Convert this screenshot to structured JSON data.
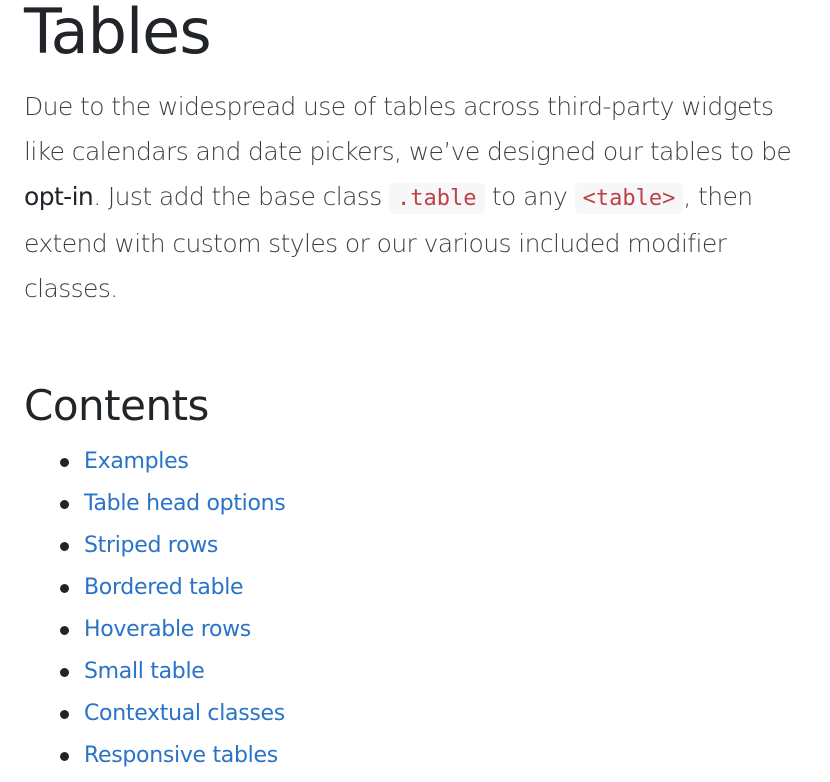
{
  "page": {
    "title": "Tables",
    "lead": {
      "part1": "Due to the widespread use of tables across third-party widgets like calendars and date pickers, we’ve designed our tables to be ",
      "emphasis": "opt-in",
      "part2": ". Just add the base class ",
      "code1": ".table",
      "part3": " to any ",
      "code2": "<table>",
      "part4": ", then extend with custom styles or our various included modifier classes."
    }
  },
  "contents": {
    "title": "Contents",
    "items": [
      {
        "label": "Examples"
      },
      {
        "label": "Table head options"
      },
      {
        "label": "Striped rows"
      },
      {
        "label": "Bordered table"
      },
      {
        "label": "Hoverable rows"
      },
      {
        "label": "Small table"
      },
      {
        "label": "Contextual classes"
      },
      {
        "label": "Responsive tables"
      }
    ]
  },
  "colors": {
    "text": "#212529",
    "link": "#2a73c6",
    "code_text": "#bd4147",
    "code_bg": "#f7f7f9"
  }
}
